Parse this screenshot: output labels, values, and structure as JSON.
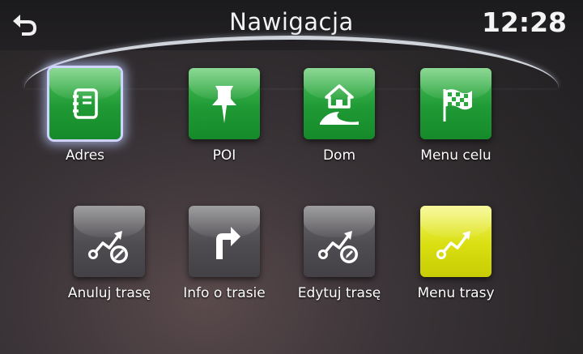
{
  "header": {
    "title": "Nawigacja",
    "time": "12:28",
    "back_icon": "back-arrow-icon"
  },
  "tiles": [
    {
      "label": "Adres",
      "icon": "address-book-icon",
      "color": "#2aa83e",
      "selected": true
    },
    {
      "label": "POI",
      "icon": "pushpin-icon",
      "color": "#2aa83e"
    },
    {
      "label": "Dom",
      "icon": "home-icon",
      "color": "#2aa83e"
    },
    {
      "label": "Menu celu",
      "icon": "checkered-flag-icon",
      "color": "#2aa83e"
    },
    {
      "label": "Anuluj trasę",
      "icon": "route-cancel-icon",
      "color": "#56545a"
    },
    {
      "label": "Info o trasie",
      "icon": "turn-right-arrow-icon",
      "color": "#56545a"
    },
    {
      "label": "Edytuj trasę",
      "icon": "route-edit-icon",
      "color": "#56545a"
    },
    {
      "label": "Menu trasy",
      "icon": "route-icon",
      "color": "#d6dc12"
    }
  ]
}
